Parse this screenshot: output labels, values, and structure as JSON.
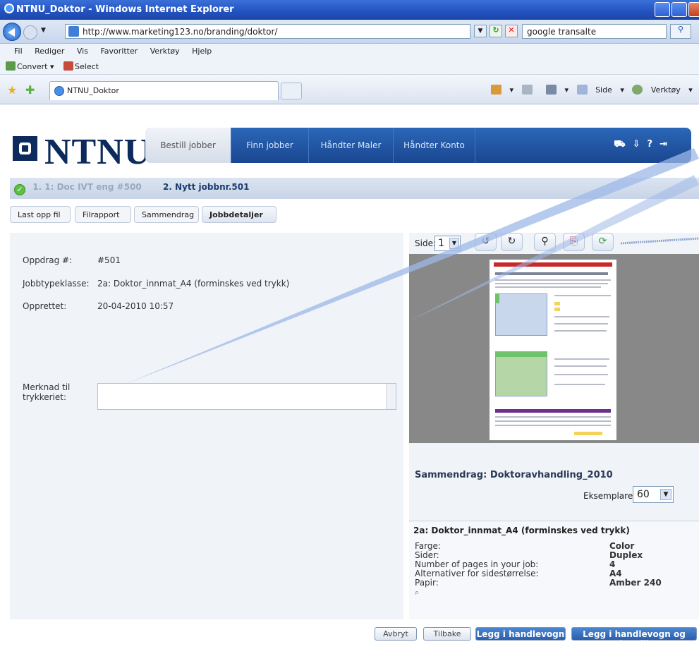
{
  "window": {
    "title": "NTNU_Doktor - Windows Internet Explorer"
  },
  "address": {
    "url": "http://www.marketing123.no/branding/doktor/",
    "search": "google transalte"
  },
  "menu": [
    "Fil",
    "Rediger",
    "Vis",
    "Favoritter",
    "Verktøy",
    "Hjelp"
  ],
  "toolbar": {
    "convert": "Convert",
    "select": "Select"
  },
  "tab": {
    "label": "NTNU_Doktor"
  },
  "commandbar": {
    "side": "Side",
    "verktoy": "Verktøy"
  },
  "logo": {
    "text": "NTNU"
  },
  "nav": {
    "items": [
      "Bestill jobber",
      "Finn jobber",
      "Håndter Maler",
      "Håndter Konto"
    ],
    "icons": [
      "cart-icon",
      "download-icon",
      "help-icon",
      "logout-icon"
    ]
  },
  "breadcrumb": {
    "done": "1. 1: Doc IVT eng #500",
    "current": "2. Nytt jobbnr.501"
  },
  "steps": [
    "Last opp fil",
    "Filrapport",
    "Sammendrag",
    "Jobbdetaljer"
  ],
  "details": {
    "order_label": "Oppdrag #:",
    "order_value": "#501",
    "type_label": "Jobbtypeklasse:",
    "type_value": "2a: Doktor_innmat_A4 (forminskes ved trykk)",
    "created_label": "Opprettet:",
    "created_value": "20-04-2010 10:57",
    "note_label_1": "Merknad til",
    "note_label_2": "trykkeriet:"
  },
  "preview": {
    "side_label": "Side:",
    "side_value": "1"
  },
  "summary": {
    "title": "Sammendrag: Doktoravhandling_2010",
    "copies_label": "Eksemplarer:",
    "copies_value": "60",
    "job_title": "2a: Doktor_innmat_A4 (forminskes ved trykk)",
    "rows": [
      {
        "label": "Farge:",
        "value": "Color"
      },
      {
        "label": "Sider:",
        "value": "Duplex"
      },
      {
        "label": "Number of pages in your job:",
        "value": "4"
      },
      {
        "label": "Alternativer for sidestørrelse:",
        "value": "A4"
      },
      {
        "label": "Papir:",
        "value": "Amber 240"
      }
    ]
  },
  "buttons": {
    "cancel": "Avbryt",
    "back": "Tilbake",
    "add_cart": "Legg i handlevogn",
    "add_order": "Legg i handlevogn og bestill"
  }
}
